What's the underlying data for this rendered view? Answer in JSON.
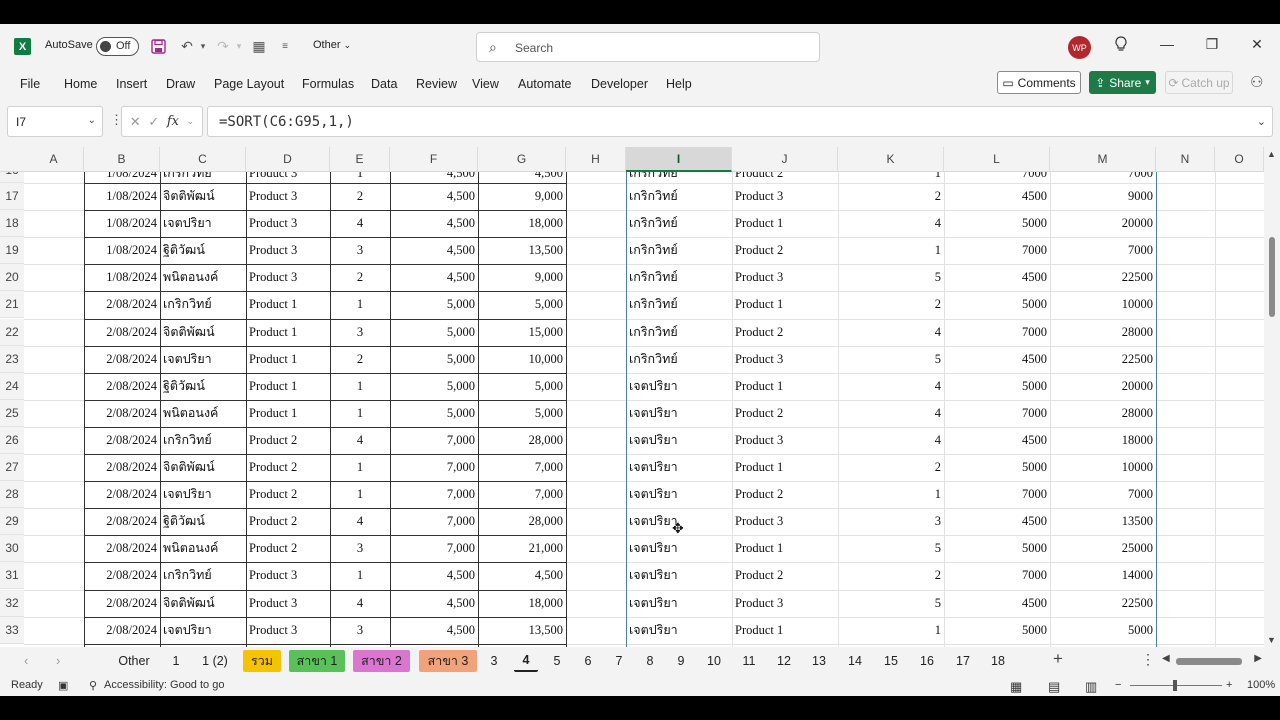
{
  "titlebar": {
    "autosave_label": "AutoSave",
    "autosave_state": "Off",
    "file_name": "Other",
    "search_placeholder": "Search",
    "avatar_initials": "WP"
  },
  "menu": {
    "items": [
      "File",
      "Home",
      "Insert",
      "Draw",
      "Page Layout",
      "Formulas",
      "Data",
      "Review",
      "View",
      "Automate",
      "Developer",
      "Help"
    ],
    "comments_label": "Comments",
    "share_label": "Share",
    "catchup_label": "Catch up"
  },
  "formula_bar": {
    "name_box": "I7",
    "formula": "=SORT(C6:G95,1,)"
  },
  "grid": {
    "columns": [
      "A",
      "B",
      "C",
      "D",
      "E",
      "F",
      "G",
      "H",
      "I",
      "J",
      "K",
      "L",
      "M",
      "N",
      "O"
    ],
    "selected_column": "I",
    "partial_top_row": {
      "row": "16",
      "cells": [
        "1/08/2024",
        "เกริกวิทย์",
        "Product 3",
        "1",
        "4,500",
        "4,500",
        "เกริกวิทย์",
        "Product 2",
        "1",
        "7000",
        "7000"
      ]
    },
    "rows": [
      {
        "row": "17",
        "b": "1/08/2024",
        "c": "จิตติพัฒน์",
        "d": "Product 3",
        "e": "2",
        "f": "4,500",
        "g": "9,000",
        "i": "เกริกวิทย์",
        "j": "Product 3",
        "k": "2",
        "l": "4500",
        "m": "9000"
      },
      {
        "row": "18",
        "b": "1/08/2024",
        "c": "เจตปริยา",
        "d": "Product 3",
        "e": "4",
        "f": "4,500",
        "g": "18,000",
        "i": "เกริกวิทย์",
        "j": "Product 1",
        "k": "4",
        "l": "5000",
        "m": "20000"
      },
      {
        "row": "19",
        "b": "1/08/2024",
        "c": "ฐิติวัฒน์",
        "d": "Product 3",
        "e": "3",
        "f": "4,500",
        "g": "13,500",
        "i": "เกริกวิทย์",
        "j": "Product 2",
        "k": "1",
        "l": "7000",
        "m": "7000"
      },
      {
        "row": "20",
        "b": "1/08/2024",
        "c": "พนิตอนงค์",
        "d": "Product 3",
        "e": "2",
        "f": "4,500",
        "g": "9,000",
        "i": "เกริกวิทย์",
        "j": "Product 3",
        "k": "5",
        "l": "4500",
        "m": "22500"
      },
      {
        "row": "21",
        "b": "2/08/2024",
        "c": "เกริกวิทย์",
        "d": "Product 1",
        "e": "1",
        "f": "5,000",
        "g": "5,000",
        "i": "เกริกวิทย์",
        "j": "Product 1",
        "k": "2",
        "l": "5000",
        "m": "10000"
      },
      {
        "row": "22",
        "b": "2/08/2024",
        "c": "จิตติพัฒน์",
        "d": "Product 1",
        "e": "3",
        "f": "5,000",
        "g": "15,000",
        "i": "เกริกวิทย์",
        "j": "Product 2",
        "k": "4",
        "l": "7000",
        "m": "28000"
      },
      {
        "row": "23",
        "b": "2/08/2024",
        "c": "เจตปริยา",
        "d": "Product 1",
        "e": "2",
        "f": "5,000",
        "g": "10,000",
        "i": "เกริกวิทย์",
        "j": "Product 3",
        "k": "5",
        "l": "4500",
        "m": "22500"
      },
      {
        "row": "24",
        "b": "2/08/2024",
        "c": "ฐิติวัฒน์",
        "d": "Product 1",
        "e": "1",
        "f": "5,000",
        "g": "5,000",
        "i": "เจตปริยา",
        "j": "Product 1",
        "k": "4",
        "l": "5000",
        "m": "20000"
      },
      {
        "row": "25",
        "b": "2/08/2024",
        "c": "พนิตอนงค์",
        "d": "Product 1",
        "e": "1",
        "f": "5,000",
        "g": "5,000",
        "i": "เจตปริยา",
        "j": "Product 2",
        "k": "4",
        "l": "7000",
        "m": "28000"
      },
      {
        "row": "26",
        "b": "2/08/2024",
        "c": "เกริกวิทย์",
        "d": "Product 2",
        "e": "4",
        "f": "7,000",
        "g": "28,000",
        "i": "เจตปริยา",
        "j": "Product 3",
        "k": "4",
        "l": "4500",
        "m": "18000"
      },
      {
        "row": "27",
        "b": "2/08/2024",
        "c": "จิตติพัฒน์",
        "d": "Product 2",
        "e": "1",
        "f": "7,000",
        "g": "7,000",
        "i": "เจตปริยา",
        "j": "Product 1",
        "k": "2",
        "l": "5000",
        "m": "10000"
      },
      {
        "row": "28",
        "b": "2/08/2024",
        "c": "เจตปริยา",
        "d": "Product 2",
        "e": "1",
        "f": "7,000",
        "g": "7,000",
        "i": "เจตปริยา",
        "j": "Product 2",
        "k": "1",
        "l": "7000",
        "m": "7000"
      },
      {
        "row": "29",
        "b": "2/08/2024",
        "c": "ฐิติวัฒน์",
        "d": "Product 2",
        "e": "4",
        "f": "7,000",
        "g": "28,000",
        "i": "เจตปริยา",
        "j": "Product 3",
        "k": "3",
        "l": "4500",
        "m": "13500"
      },
      {
        "row": "30",
        "b": "2/08/2024",
        "c": "พนิตอนงค์",
        "d": "Product 2",
        "e": "3",
        "f": "7,000",
        "g": "21,000",
        "i": "เจตปริยา",
        "j": "Product 1",
        "k": "5",
        "l": "5000",
        "m": "25000"
      },
      {
        "row": "31",
        "b": "2/08/2024",
        "c": "เกริกวิทย์",
        "d": "Product 3",
        "e": "1",
        "f": "4,500",
        "g": "4,500",
        "i": "เจตปริยา",
        "j": "Product 2",
        "k": "2",
        "l": "7000",
        "m": "14000"
      },
      {
        "row": "32",
        "b": "2/08/2024",
        "c": "จิตติพัฒน์",
        "d": "Product 3",
        "e": "4",
        "f": "4,500",
        "g": "18,000",
        "i": "เจตปริยา",
        "j": "Product 3",
        "k": "5",
        "l": "4500",
        "m": "22500"
      },
      {
        "row": "33",
        "b": "2/08/2024",
        "c": "เจตปริยา",
        "d": "Product 3",
        "e": "3",
        "f": "4,500",
        "g": "13,500",
        "i": "เจตปริยา",
        "j": "Product 1",
        "k": "1",
        "l": "5000",
        "m": "5000"
      }
    ]
  },
  "sheet_tabs": [
    {
      "label": "Other",
      "color": ""
    },
    {
      "label": "1",
      "color": ""
    },
    {
      "label": "1 (2)",
      "color": ""
    },
    {
      "label": "รวม",
      "color": "#f5c400"
    },
    {
      "label": "สาขา 1",
      "color": "#59c05a"
    },
    {
      "label": "สาขา 2",
      "color": "#d977d0"
    },
    {
      "label": "สาขา 3",
      "color": "#f0a27a"
    },
    {
      "label": "3",
      "color": ""
    },
    {
      "label": "4",
      "color": "",
      "active": true
    },
    {
      "label": "5",
      "color": ""
    },
    {
      "label": "6",
      "color": ""
    },
    {
      "label": "7",
      "color": ""
    },
    {
      "label": "8",
      "color": ""
    },
    {
      "label": "9",
      "color": ""
    },
    {
      "label": "10",
      "color": ""
    },
    {
      "label": "11",
      "color": ""
    },
    {
      "label": "12",
      "color": ""
    },
    {
      "label": "13",
      "color": ""
    },
    {
      "label": "14",
      "color": ""
    },
    {
      "label": "15",
      "color": ""
    },
    {
      "label": "16",
      "color": ""
    },
    {
      "label": "17",
      "color": ""
    },
    {
      "label": "18",
      "color": ""
    }
  ],
  "status": {
    "ready": "Ready",
    "accessibility": "Accessibility: Good to go",
    "zoom": "100%"
  }
}
